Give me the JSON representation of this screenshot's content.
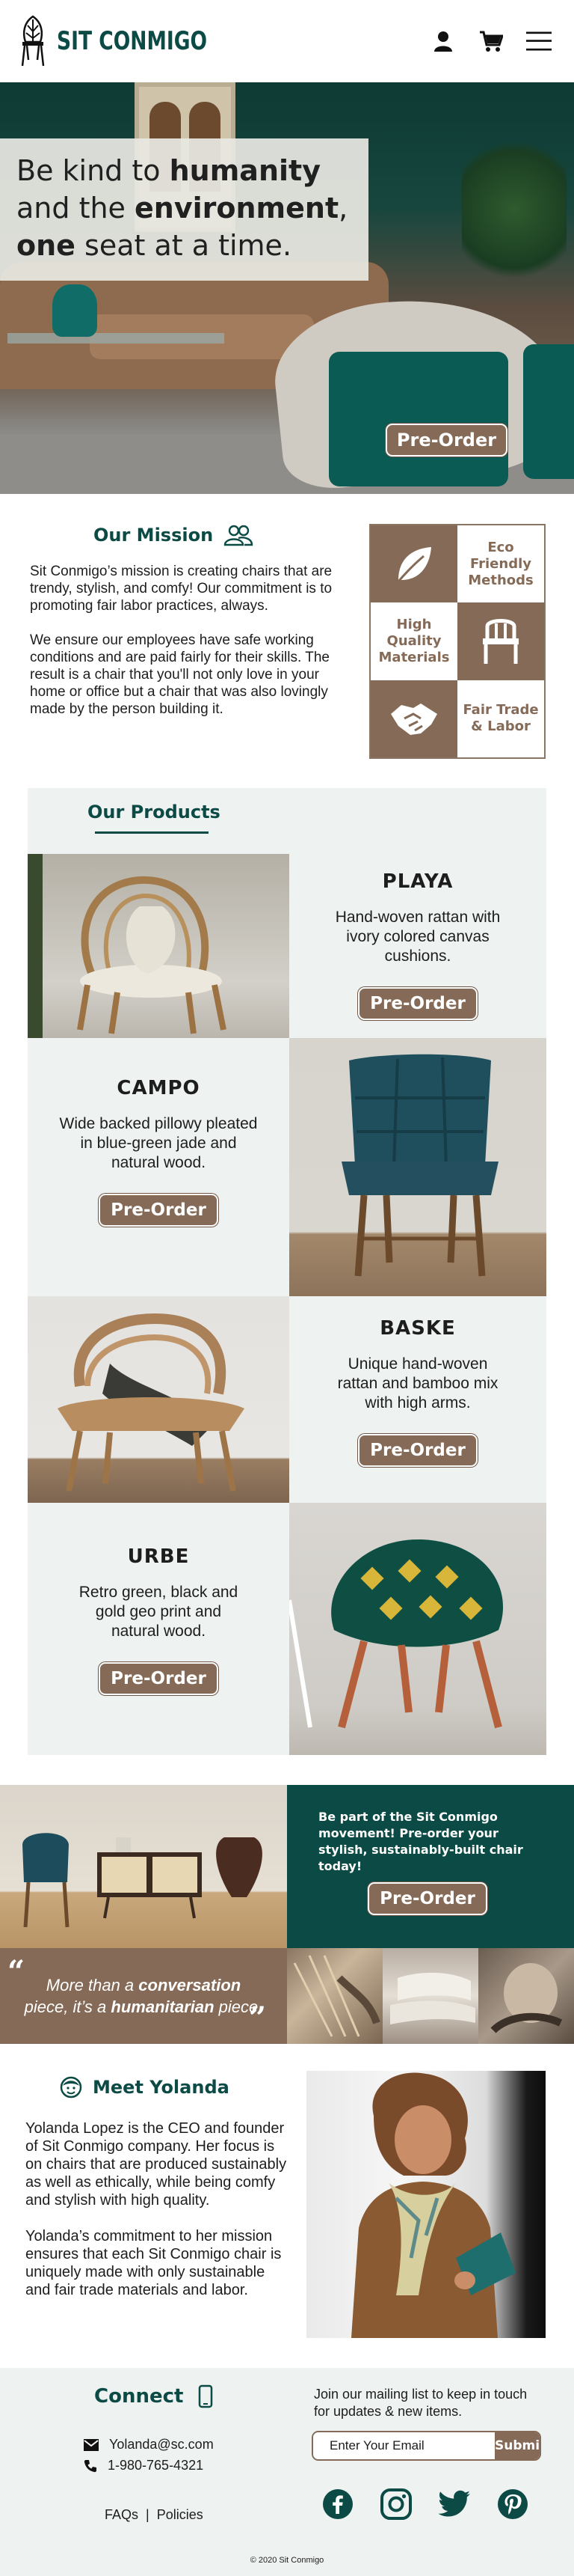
{
  "brand": {
    "name": "SIT CONMIGO"
  },
  "header": {
    "icons": [
      "user-icon",
      "cart-icon",
      "hamburger-menu-icon"
    ]
  },
  "hero": {
    "line1_pre": "Be kind to ",
    "line1_bold": "humanity",
    "line2_pre": "and the ",
    "line2_bold": "environment",
    "line2_post": ",",
    "line3_bold": "one",
    "line3_post": " seat at a time.",
    "cta_label": "Pre-Order"
  },
  "mission": {
    "title": "Our Mission",
    "icon": "people-icon",
    "paragraph1": "Sit Conmigo’s mission is creating chairs that are trendy, stylish, and comfy! Our commitment is to promoting fair labor practices, always.",
    "paragraph2": "We ensure our employees have safe working conditions and are paid fairly for their skills. The result is a chair that you'll not only love in your home or office but a chair that was also lovingly made by the person building it."
  },
  "features": [
    {
      "type": "icon",
      "icon": "leaf-icon"
    },
    {
      "type": "label",
      "label": "Eco Friendly Methods"
    },
    {
      "type": "label",
      "label": "High Quality Materials"
    },
    {
      "type": "icon",
      "icon": "chair-icon"
    },
    {
      "type": "icon",
      "icon": "handshake-icon"
    },
    {
      "type": "label",
      "label": "Fair Trade & Labor"
    }
  ],
  "products": {
    "title": "Our Products",
    "items": [
      {
        "name": "PLAYA",
        "description": "Hand-woven rattan with ivory colored canvas cushions.",
        "cta": "Pre-Order"
      },
      {
        "name": "CAMPO",
        "description": "Wide backed pillowy pleated in blue-green jade and natural wood.",
        "cta": "Pre-Order"
      },
      {
        "name": "BASKE",
        "description": "Unique hand-woven rattan and bamboo mix with high arms.",
        "cta": "Pre-Order"
      },
      {
        "name": "URBE",
        "description": "Retro green, black and gold geo print and natural wood.",
        "cta": "Pre-Order"
      }
    ]
  },
  "banner": {
    "text": "Be part of the Sit Conmigo movement! Pre-order your stylish, sustainably-built chair today!",
    "cta": "Pre-Order",
    "quote_pre": "More than a ",
    "quote_bold1": "conversation",
    "quote_mid": " piece, it’s a ",
    "quote_bold2": "humanitarian",
    "quote_post": " piece."
  },
  "meet": {
    "title": "Meet Yolanda",
    "icon": "face-icon",
    "paragraph1": "Yolanda Lopez is the CEO and founder of Sit Conmigo company. Her focus is on chairs that are produced sustainably as well as ethically, while being comfy and stylish with high quality.",
    "paragraph2": "Yolanda’s commitment to her mission ensures that each Sit Conmigo chair is uniquely made with only sustainable and fair trade materials and labor."
  },
  "footer": {
    "connect_title": "Connect",
    "email": "Yolanda@sc.com",
    "phone": "1-980-765-4321",
    "link_faqs": "FAQs",
    "separator": "|",
    "link_policies": "Policies",
    "mailing_text": "Join our mailing list to keep in touch for updates & new items.",
    "email_placeholder": "Enter Your Email",
    "submit_label": "Submit",
    "socials": [
      "facebook-icon",
      "instagram-icon",
      "twitter-icon",
      "pinterest-icon"
    ],
    "copyright": "2020 Sit Conmigo"
  },
  "colors": {
    "brand_green": "#0c4a45",
    "accent_brown": "#856b57",
    "panel_bg": "#eef2f1"
  }
}
